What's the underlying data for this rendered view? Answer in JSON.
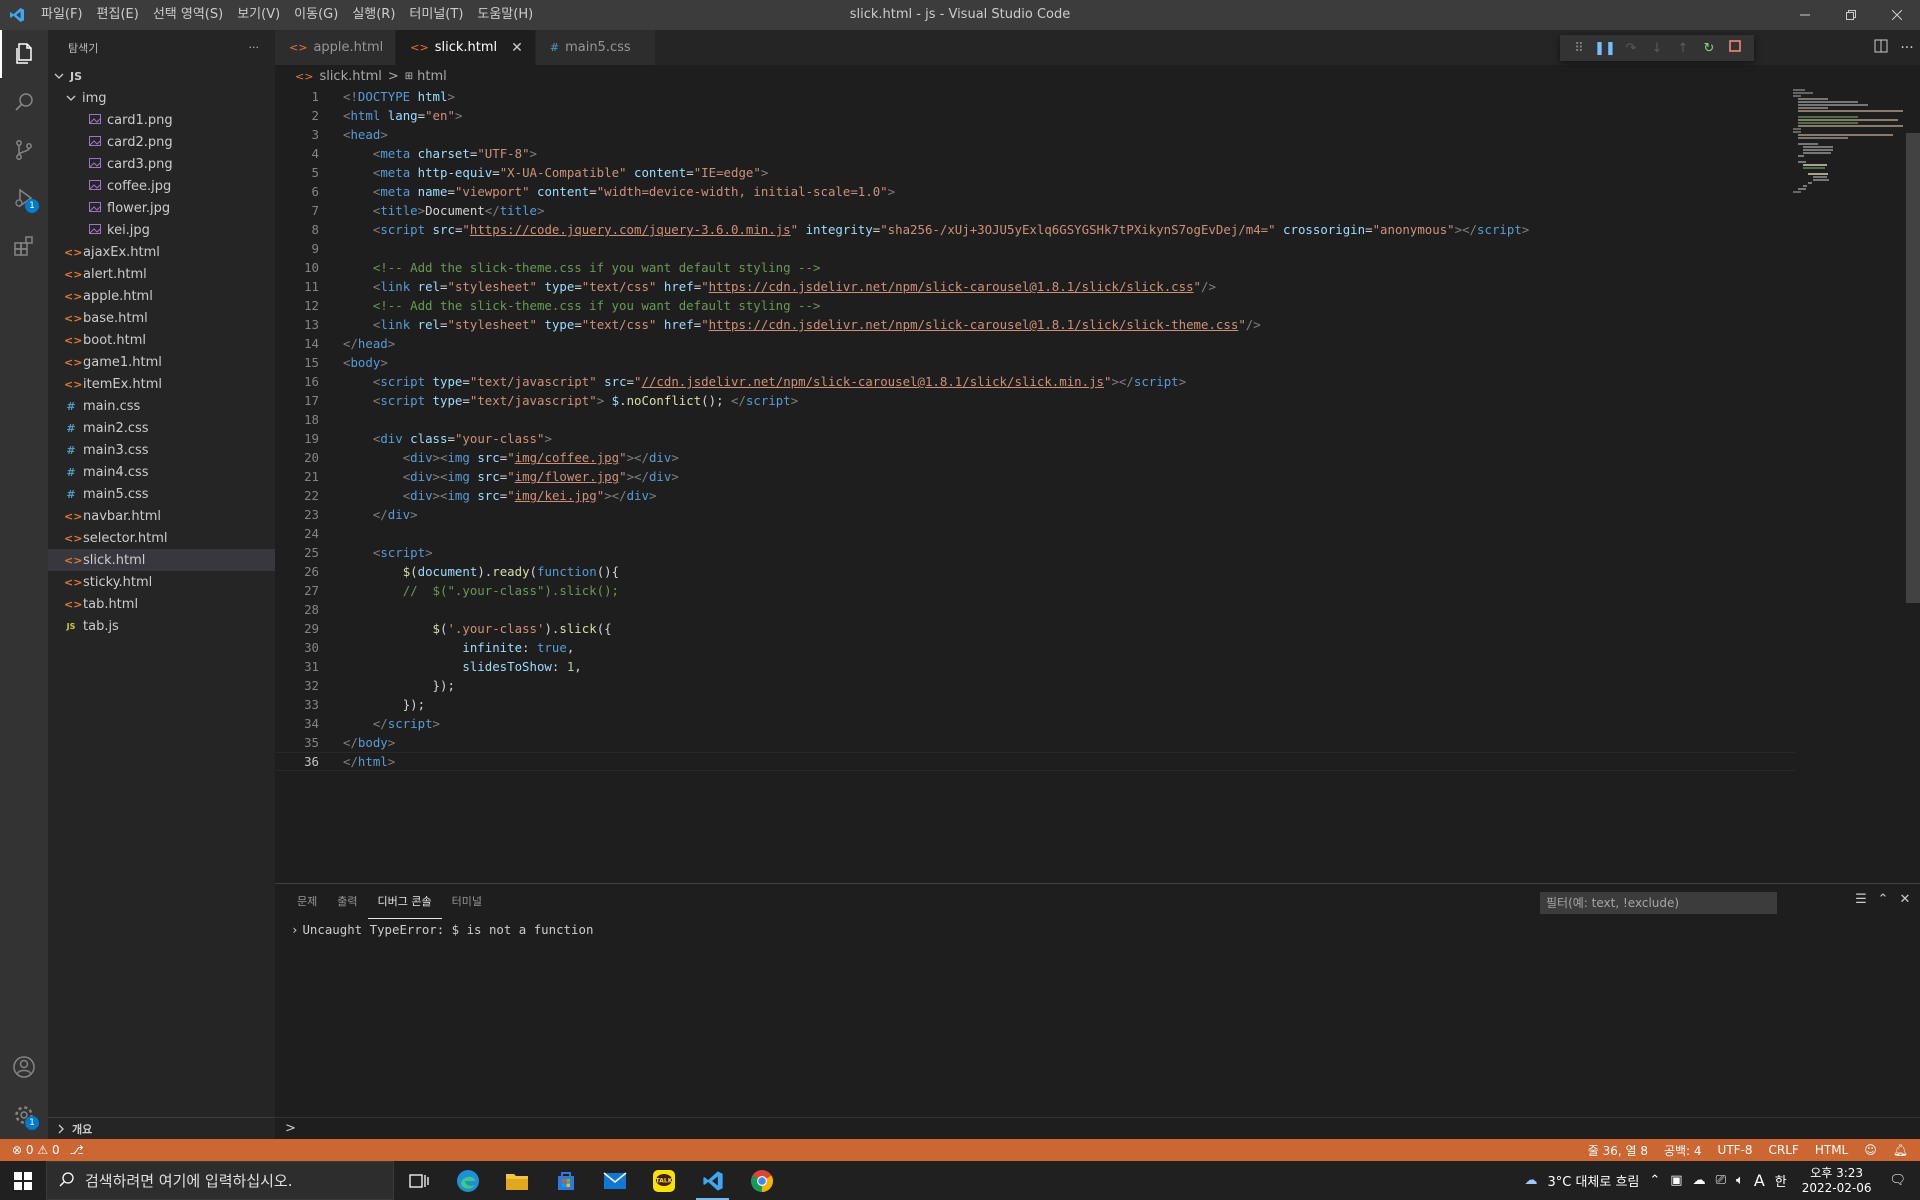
{
  "window": {
    "title": "slick.html - js - Visual Studio Code"
  },
  "menu": [
    "파일(F)",
    "편집(E)",
    "선택 영역(S)",
    "보기(V)",
    "이동(G)",
    "실행(R)",
    "터미널(T)",
    "도움말(H)"
  ],
  "activity": {
    "debug_badge": "1",
    "settings_badge": "1"
  },
  "sidebar": {
    "title": "탐색기",
    "more": "···",
    "root": "JS",
    "folder": "img",
    "img_files": [
      "card1.png",
      "card2.png",
      "card3.png",
      "coffee.jpg",
      "flower.jpg",
      "kei.jpg"
    ],
    "files": [
      {
        "name": "ajaxEx.html",
        "icon": "<>"
      },
      {
        "name": "alert.html",
        "icon": "<>"
      },
      {
        "name": "apple.html",
        "icon": "<>"
      },
      {
        "name": "base.html",
        "icon": "<>"
      },
      {
        "name": "boot.html",
        "icon": "<>"
      },
      {
        "name": "game1.html",
        "icon": "<>"
      },
      {
        "name": "itemEx.html",
        "icon": "<>"
      },
      {
        "name": "main.css",
        "icon": "#"
      },
      {
        "name": "main2.css",
        "icon": "#"
      },
      {
        "name": "main3.css",
        "icon": "#"
      },
      {
        "name": "main4.css",
        "icon": "#"
      },
      {
        "name": "main5.css",
        "icon": "#"
      },
      {
        "name": "navbar.html",
        "icon": "<>"
      },
      {
        "name": "selector.html",
        "icon": "<>"
      },
      {
        "name": "slick.html",
        "icon": "<>",
        "selected": true
      },
      {
        "name": "sticky.html",
        "icon": "<>"
      },
      {
        "name": "tab.html",
        "icon": "<>"
      },
      {
        "name": "tab.js",
        "icon": "JS"
      }
    ],
    "outline": "개요"
  },
  "tabs": [
    {
      "label": "apple.html",
      "icon": "<>",
      "active": false
    },
    {
      "label": "slick.html",
      "icon": "<>",
      "active": true
    },
    {
      "label": "main5.css",
      "icon": "#",
      "active": false
    }
  ],
  "breadcrumb": {
    "file": "slick.html",
    "sep": ">",
    "node": "html"
  },
  "code": [
    [
      [
        "tg",
        "<!"
      ],
      [
        "tn",
        "DOCTYPE"
      ],
      [
        "tx",
        " "
      ],
      [
        "at",
        "html"
      ],
      [
        "tg",
        ">"
      ]
    ],
    [
      [
        "tg",
        "<"
      ],
      [
        "tn",
        "html"
      ],
      [
        "tx",
        " "
      ],
      [
        "at",
        "lang"
      ],
      [
        "tx",
        "="
      ],
      [
        "sv",
        "\"en\""
      ],
      [
        "tg",
        ">"
      ]
    ],
    [
      [
        "tg",
        "<"
      ],
      [
        "tn",
        "head"
      ],
      [
        "tg",
        ">"
      ]
    ],
    [
      [
        "tx",
        "    "
      ],
      [
        "tg",
        "<"
      ],
      [
        "tn",
        "meta"
      ],
      [
        "tx",
        " "
      ],
      [
        "at",
        "charset"
      ],
      [
        "tx",
        "="
      ],
      [
        "sv",
        "\"UTF-8\""
      ],
      [
        "tg",
        ">"
      ]
    ],
    [
      [
        "tx",
        "    "
      ],
      [
        "tg",
        "<"
      ],
      [
        "tn",
        "meta"
      ],
      [
        "tx",
        " "
      ],
      [
        "at",
        "http-equiv"
      ],
      [
        "tx",
        "="
      ],
      [
        "sv",
        "\"X-UA-Compatible\""
      ],
      [
        "tx",
        " "
      ],
      [
        "at",
        "content"
      ],
      [
        "tx",
        "="
      ],
      [
        "sv",
        "\"IE=edge\""
      ],
      [
        "tg",
        ">"
      ]
    ],
    [
      [
        "tx",
        "    "
      ],
      [
        "tg",
        "<"
      ],
      [
        "tn",
        "meta"
      ],
      [
        "tx",
        " "
      ],
      [
        "at",
        "name"
      ],
      [
        "tx",
        "="
      ],
      [
        "sv",
        "\"viewport\""
      ],
      [
        "tx",
        " "
      ],
      [
        "at",
        "content"
      ],
      [
        "tx",
        "="
      ],
      [
        "sv",
        "\"width=device-width, initial-scale=1.0\""
      ],
      [
        "tg",
        ">"
      ]
    ],
    [
      [
        "tx",
        "    "
      ],
      [
        "tg",
        "<"
      ],
      [
        "tn",
        "title"
      ],
      [
        "tg",
        ">"
      ],
      [
        "tx",
        "Document"
      ],
      [
        "tg",
        "</"
      ],
      [
        "tn",
        "title"
      ],
      [
        "tg",
        ">"
      ]
    ],
    [
      [
        "tx",
        "    "
      ],
      [
        "tg",
        "<"
      ],
      [
        "tn",
        "script"
      ],
      [
        "tx",
        " "
      ],
      [
        "at",
        "src"
      ],
      [
        "tx",
        "="
      ],
      [
        "sv",
        "\""
      ],
      [
        "svu",
        "https://code.jquery.com/jquery-3.6.0.min.js"
      ],
      [
        "sv",
        "\""
      ],
      [
        "tx",
        " "
      ],
      [
        "at",
        "integrity"
      ],
      [
        "tx",
        "="
      ],
      [
        "sv",
        "\"sha256-/xUj+3OJU5yExlq6GSYGSHk7tPXikynS7ogEvDej/m4=\""
      ],
      [
        "tx",
        " "
      ],
      [
        "at",
        "crossorigin"
      ],
      [
        "tx",
        "="
      ],
      [
        "sv",
        "\"anonymous\""
      ],
      [
        "tg",
        "></"
      ],
      [
        "tn",
        "script"
      ],
      [
        "tg",
        ">"
      ]
    ],
    [],
    [
      [
        "tx",
        "    "
      ],
      [
        "cm",
        "<!-- Add the slick-theme.css if you want default styling -->"
      ]
    ],
    [
      [
        "tx",
        "    "
      ],
      [
        "tg",
        "<"
      ],
      [
        "tn",
        "link"
      ],
      [
        "tx",
        " "
      ],
      [
        "at",
        "rel"
      ],
      [
        "tx",
        "="
      ],
      [
        "sv",
        "\"stylesheet\""
      ],
      [
        "tx",
        " "
      ],
      [
        "at",
        "type"
      ],
      [
        "tx",
        "="
      ],
      [
        "sv",
        "\"text/css\""
      ],
      [
        "tx",
        " "
      ],
      [
        "at",
        "href"
      ],
      [
        "tx",
        "="
      ],
      [
        "sv",
        "\""
      ],
      [
        "svu",
        "https://cdn.jsdelivr.net/npm/slick-carousel@1.8.1/slick/slick.css"
      ],
      [
        "sv",
        "\""
      ],
      [
        "tg",
        "/>"
      ]
    ],
    [
      [
        "tx",
        "    "
      ],
      [
        "cm",
        "<!-- Add the slick-theme.css if you want default styling -->"
      ]
    ],
    [
      [
        "tx",
        "    "
      ],
      [
        "tg",
        "<"
      ],
      [
        "tn",
        "link"
      ],
      [
        "tx",
        " "
      ],
      [
        "at",
        "rel"
      ],
      [
        "tx",
        "="
      ],
      [
        "sv",
        "\"stylesheet\""
      ],
      [
        "tx",
        " "
      ],
      [
        "at",
        "type"
      ],
      [
        "tx",
        "="
      ],
      [
        "sv",
        "\"text/css\""
      ],
      [
        "tx",
        " "
      ],
      [
        "at",
        "href"
      ],
      [
        "tx",
        "="
      ],
      [
        "sv",
        "\""
      ],
      [
        "svu",
        "https://cdn.jsdelivr.net/npm/slick-carousel@1.8.1/slick/slick-theme.css"
      ],
      [
        "sv",
        "\""
      ],
      [
        "tg",
        "/>"
      ]
    ],
    [
      [
        "tg",
        "</"
      ],
      [
        "tn",
        "head"
      ],
      [
        "tg",
        ">"
      ]
    ],
    [
      [
        "tg",
        "<"
      ],
      [
        "tn",
        "body"
      ],
      [
        "tg",
        ">"
      ]
    ],
    [
      [
        "tx",
        "    "
      ],
      [
        "tg",
        "<"
      ],
      [
        "tn",
        "script"
      ],
      [
        "tx",
        " "
      ],
      [
        "at",
        "type"
      ],
      [
        "tx",
        "="
      ],
      [
        "sv",
        "\"text/javascript\""
      ],
      [
        "tx",
        " "
      ],
      [
        "at",
        "src"
      ],
      [
        "tx",
        "="
      ],
      [
        "sv",
        "\""
      ],
      [
        "svu",
        "//cdn.jsdelivr.net/npm/slick-carousel@1.8.1/slick/slick.min.js"
      ],
      [
        "sv",
        "\""
      ],
      [
        "tg",
        "></"
      ],
      [
        "tn",
        "script"
      ],
      [
        "tg",
        ">"
      ]
    ],
    [
      [
        "tx",
        "    "
      ],
      [
        "tg",
        "<"
      ],
      [
        "tn",
        "script"
      ],
      [
        "tx",
        " "
      ],
      [
        "at",
        "type"
      ],
      [
        "tx",
        "="
      ],
      [
        "sv",
        "\"text/javascript\""
      ],
      [
        "tg",
        ">"
      ],
      [
        "tx",
        " "
      ],
      [
        "at",
        "$"
      ],
      [
        "tx",
        "."
      ],
      [
        "fn",
        "noConflict"
      ],
      [
        "tx",
        "(); "
      ],
      [
        "tg",
        "</"
      ],
      [
        "tn",
        "script"
      ],
      [
        "tg",
        ">"
      ]
    ],
    [],
    [
      [
        "tx",
        "    "
      ],
      [
        "tg",
        "<"
      ],
      [
        "tn",
        "div"
      ],
      [
        "tx",
        " "
      ],
      [
        "at",
        "class"
      ],
      [
        "tx",
        "="
      ],
      [
        "sv",
        "\"your-class\""
      ],
      [
        "tg",
        ">"
      ]
    ],
    [
      [
        "tx",
        "        "
      ],
      [
        "tg",
        "<"
      ],
      [
        "tn",
        "div"
      ],
      [
        "tg",
        "><"
      ],
      [
        "tn",
        "img"
      ],
      [
        "tx",
        " "
      ],
      [
        "at",
        "src"
      ],
      [
        "tx",
        "="
      ],
      [
        "sv",
        "\""
      ],
      [
        "svu",
        "img/coffee.jpg"
      ],
      [
        "sv",
        "\""
      ],
      [
        "tg",
        "></"
      ],
      [
        "tn",
        "div"
      ],
      [
        "tg",
        ">"
      ]
    ],
    [
      [
        "tx",
        "        "
      ],
      [
        "tg",
        "<"
      ],
      [
        "tn",
        "div"
      ],
      [
        "tg",
        "><"
      ],
      [
        "tn",
        "img"
      ],
      [
        "tx",
        " "
      ],
      [
        "at",
        "src"
      ],
      [
        "tx",
        "="
      ],
      [
        "sv",
        "\""
      ],
      [
        "svu",
        "img/flower.jpg"
      ],
      [
        "sv",
        "\""
      ],
      [
        "tg",
        "></"
      ],
      [
        "tn",
        "div"
      ],
      [
        "tg",
        ">"
      ]
    ],
    [
      [
        "tx",
        "        "
      ],
      [
        "tg",
        "<"
      ],
      [
        "tn",
        "div"
      ],
      [
        "tg",
        "><"
      ],
      [
        "tn",
        "img"
      ],
      [
        "tx",
        " "
      ],
      [
        "at",
        "src"
      ],
      [
        "tx",
        "="
      ],
      [
        "sv",
        "\""
      ],
      [
        "svu",
        "img/kei.jpg"
      ],
      [
        "sv",
        "\""
      ],
      [
        "tg",
        "></"
      ],
      [
        "tn",
        "div"
      ],
      [
        "tg",
        ">"
      ]
    ],
    [
      [
        "tx",
        "    "
      ],
      [
        "tg",
        "</"
      ],
      [
        "tn",
        "div"
      ],
      [
        "tg",
        ">"
      ]
    ],
    [],
    [
      [
        "tx",
        "    "
      ],
      [
        "tg",
        "<"
      ],
      [
        "tn",
        "script"
      ],
      [
        "tg",
        ">"
      ]
    ],
    [
      [
        "tx",
        "        "
      ],
      [
        "fn",
        "$"
      ],
      [
        "tx",
        "("
      ],
      [
        "at",
        "document"
      ],
      [
        "tx",
        ")."
      ],
      [
        "fn",
        "ready"
      ],
      [
        "tx",
        "("
      ],
      [
        "kw",
        "function"
      ],
      [
        "tx",
        "(){"
      ]
    ],
    [
      [
        "tx",
        "        "
      ],
      [
        "cm",
        "//  $(\".your-class\").slick();"
      ]
    ],
    [],
    [
      [
        "tx",
        "            "
      ],
      [
        "fn",
        "$"
      ],
      [
        "tx",
        "("
      ],
      [
        "sv",
        "'.your-class'"
      ],
      [
        "tx",
        ")."
      ],
      [
        "fn",
        "slick"
      ],
      [
        "tx",
        "({"
      ]
    ],
    [
      [
        "tx",
        "                "
      ],
      [
        "at",
        "infinite"
      ],
      [
        "tx",
        ": "
      ],
      [
        "kw",
        "true"
      ],
      [
        "tx",
        ","
      ]
    ],
    [
      [
        "tx",
        "                "
      ],
      [
        "at",
        "slidesToShow"
      ],
      [
        "tx",
        ": "
      ],
      [
        "nm",
        "1"
      ],
      [
        "tx",
        ","
      ]
    ],
    [
      [
        "tx",
        "            "
      ],
      [
        "tx",
        "});"
      ]
    ],
    [
      [
        "tx",
        "        "
      ],
      [
        "tx",
        "});"
      ]
    ],
    [
      [
        "tx",
        "    "
      ],
      [
        "tg",
        "</"
      ],
      [
        "tn",
        "script"
      ],
      [
        "tg",
        ">"
      ]
    ],
    [
      [
        "tg",
        "</"
      ],
      [
        "tn",
        "body"
      ],
      [
        "tg",
        ">"
      ]
    ],
    [
      [
        "tg",
        "</"
      ],
      [
        "tn",
        "html"
      ],
      [
        "tg",
        ">"
      ]
    ]
  ],
  "current_line": 36,
  "panel": {
    "tabs": [
      "문제",
      "출력",
      "디버그 콘솔",
      "터미널"
    ],
    "active_tab": 2,
    "filter_placeholder": "필터(예: text, !exclude)",
    "console_lines": [
      "Uncaught TypeError: $ is not a function"
    ],
    "prompt": ">"
  },
  "status": {
    "errors": "0",
    "warnings": "0",
    "position": "줄 36, 열 8",
    "spaces": "공백: 4",
    "encoding": "UTF-8",
    "eol": "CRLF",
    "language": "HTML"
  },
  "taskbar": {
    "search_placeholder": "검색하려면 여기에 입력하십시오.",
    "weather": "3°C  대체로 흐림",
    "ime_a": "A",
    "ime_han": "한",
    "time": "오후 3:23",
    "date": "2022-02-06"
  },
  "colors": {
    "statusbar": "#cc6633",
    "accent": "#007acc"
  }
}
